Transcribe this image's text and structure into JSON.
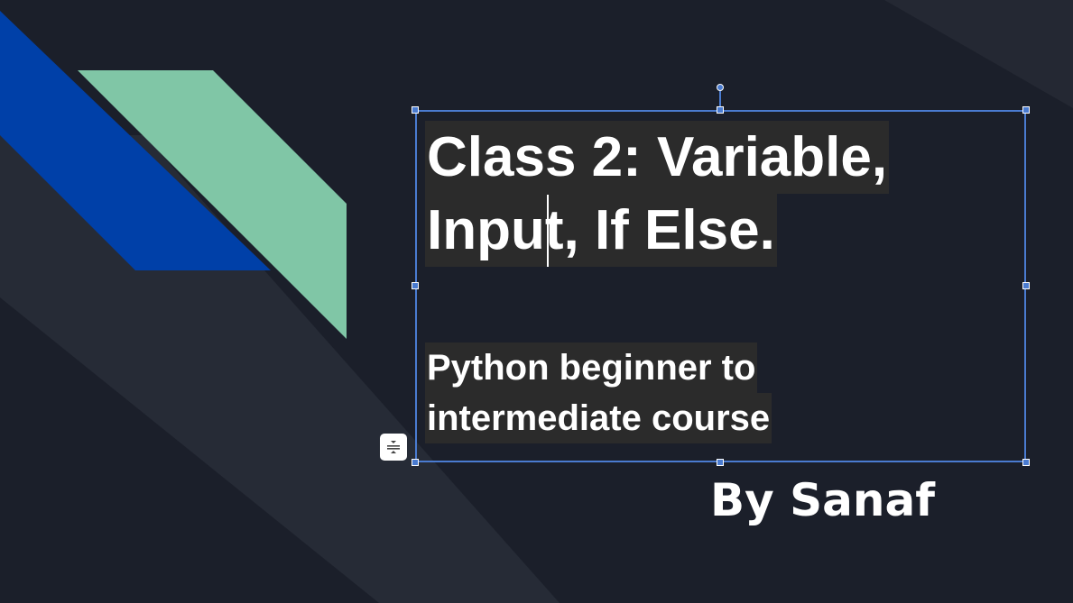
{
  "slide": {
    "title_line1": "Class 2: Variable,",
    "title_line2": "Input, If Else.",
    "subtitle_line1": "Python beginner to",
    "subtitle_line2": "intermediate course",
    "author": "By Sanaf"
  },
  "colors": {
    "background": "#1b1f2a",
    "stripe_blue": "#0040a8",
    "stripe_green": "#80c6a6",
    "selection": "#4a7bd0"
  },
  "icons": {
    "autofit": "text-autofit-icon"
  }
}
